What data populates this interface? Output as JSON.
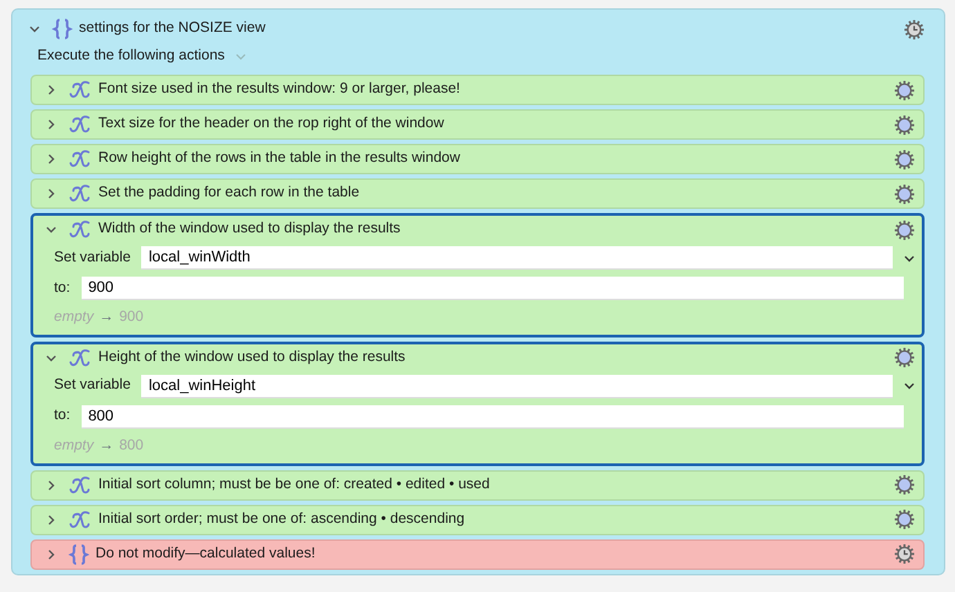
{
  "group": {
    "title": "settings for the NOSIZE view",
    "expanded": true,
    "execute_label": "Execute the following actions",
    "actions": [
      {
        "kind": "variable",
        "title": "Font size used in the results window: 9 or larger, please!",
        "expanded": false,
        "selected": false
      },
      {
        "kind": "variable",
        "title": "Text size for the header on the rop right of the window",
        "expanded": false,
        "selected": false
      },
      {
        "kind": "variable",
        "title": "Row height of the rows in the table in the results window",
        "expanded": false,
        "selected": false
      },
      {
        "kind": "variable",
        "title": "Set the padding for each row in the table",
        "expanded": false,
        "selected": false
      },
      {
        "kind": "variable",
        "title": "Width of the window used to display the results",
        "expanded": true,
        "selected": true,
        "variable_label": "Set variable",
        "variable": "local_winWidth",
        "value_label": "to:",
        "value": "900",
        "preview_from": "empty",
        "preview_arrow": "→",
        "preview_to": "900"
      },
      {
        "kind": "variable",
        "title": "Height of the window used to display the results",
        "expanded": true,
        "selected": true,
        "variable_label": "Set variable",
        "variable": "local_winHeight",
        "value_label": "to:",
        "value": "800",
        "preview_from": "empty",
        "preview_arrow": "→",
        "preview_to": "800"
      },
      {
        "kind": "variable",
        "title": "Initial sort column; must be be one of: created • edited • used",
        "expanded": false,
        "selected": false
      },
      {
        "kind": "variable",
        "title": "Initial sort order; must be one of: ascending • descending",
        "expanded": false,
        "selected": false
      },
      {
        "kind": "group",
        "title": "Do not modify—calculated values!",
        "expanded": false,
        "selected": false
      }
    ]
  }
}
